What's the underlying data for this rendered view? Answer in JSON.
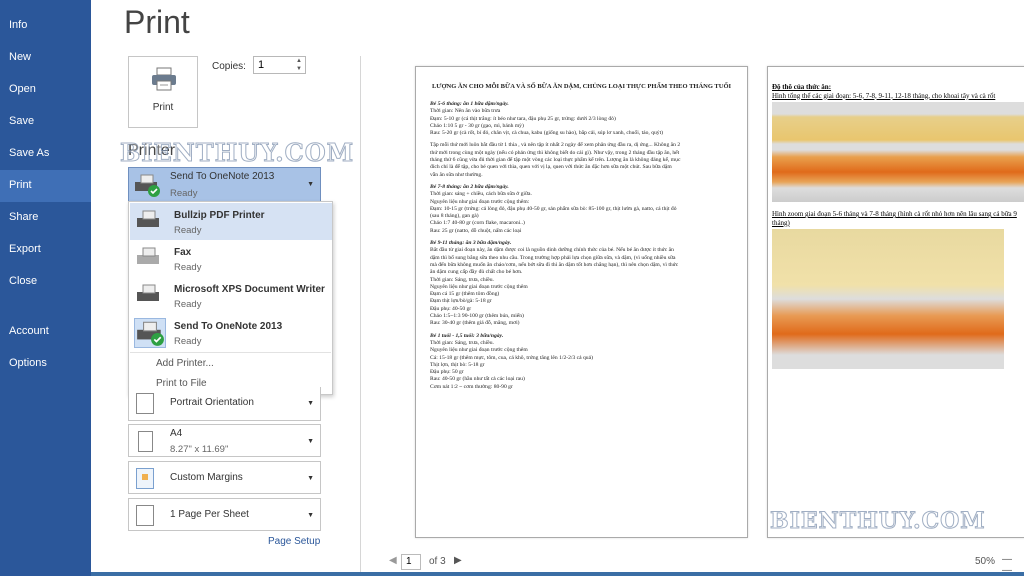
{
  "sidebar": {
    "items": [
      {
        "label": "Info"
      },
      {
        "label": "New"
      },
      {
        "label": "Open"
      },
      {
        "label": "Save"
      },
      {
        "label": "Save As"
      },
      {
        "label": "Print",
        "selected": true
      },
      {
        "label": "Share"
      },
      {
        "label": "Export"
      },
      {
        "label": "Close"
      },
      {
        "label": "Account"
      },
      {
        "label": "Options"
      }
    ],
    "color": "#2b579a"
  },
  "page_title": "Print",
  "print_button": "Print",
  "copies": {
    "label": "Copies:",
    "value": "1"
  },
  "printer": {
    "label": "Printer",
    "selected": {
      "name": "Send To OneNote 2013",
      "status": "Ready"
    },
    "list": [
      {
        "name": "Bullzip PDF Printer",
        "status": "Ready"
      },
      {
        "name": "Fax",
        "status": "Ready"
      },
      {
        "name": "Microsoft XPS Document Writer",
        "status": "Ready"
      },
      {
        "name": "Send To OneNote 2013",
        "status": "Ready"
      }
    ],
    "add_printer": "Add Printer...",
    "print_to_file": "Print to File"
  },
  "settings": [
    {
      "title": "Portrait Orientation"
    },
    {
      "title": "A4",
      "sub": "8.27\" x 11.69\""
    },
    {
      "title": "Custom Margins"
    },
    {
      "title": "1 Page Per Sheet"
    }
  ],
  "page_setup": "Page Setup",
  "watermark": "BIENTHUY.COM",
  "document": {
    "title": "LƯỢNG ĂN CHO MỖI BỮA VÀ SỐ BỮA ĂN DẶM, CHỦNG LOẠI THỰC PHẨM THEO THÁNG TUỔI",
    "lines": [
      {
        "t": "Bé 5-6 tháng: ăn 1 bữa dặm/ngày.",
        "h": true
      },
      {
        "t": "Thời gian: Nên ăn vào bữa trưa"
      },
      {
        "t": "Đạm: 5-10 gr (cá thịt trắng: ít béo như tara, đậu phụ 25 gr, trứng: dưới 2/3 lòng đỏ)"
      },
      {
        "t": "Cháo 1:10 5 gr - 30 gr (gạo, mì, bánh mỳ)"
      },
      {
        "t": "Rau: 5-20 gr (cà rốt, bí đỏ, chân vịt, cà chua, kabu (giống su hào), bắp cải, súp lơ xanh, chuối, táo, quýt)"
      },
      {
        "t": ""
      },
      {
        "t": "Tập mỗi thứ mới luôn bắt đầu từ 1 thìa , và nên tập ít nhất 2 ngày để xem phân ứng đầu ra, dị ứng... Không ăn 2"
      },
      {
        "t": "thứ mới trong cùng một ngày (nếu có phản ứng thì không biết do cái gì). Như vậy, trong 2 tháng đầu tập ăn, hết"
      },
      {
        "t": "tháng thứ 6 cũng vừa đủ thời gian để tập một vòng các loại thực phẩm kể trên. Lượng ăn là không đáng kể, mục"
      },
      {
        "t": "đích chỉ là để tập, cho bé quen với thìa, quen với vị lạ, quen với thức ăn đặc hơn sữa một chút. Sau bữa dặm"
      },
      {
        "t": "vẫn ăn sữa như thường."
      },
      {
        "t": "Bé 7-8 tháng: ăn 2 bữa dặm/ngày.",
        "h": true
      },
      {
        "t": "Thời gian: sáng + chiều, cách bữa sữa ở giữa."
      },
      {
        "t": "Nguyên liệu như giai đoạn trước cộng thêm:"
      },
      {
        "t": "Đạm: 10-15 gr (trứng: cả lòng đỏ, đậu phụ 40-50 gr, sản phẩm sữa bò: 85-100 gr, thịt lườn gà, natto, cá thịt đỏ"
      },
      {
        "t": "(sau 8 tháng), gan gà)"
      },
      {
        "t": "Cháo 1:7 40-80 gr (corn flake, macaroni..)"
      },
      {
        "t": "Rau: 25 gr (natto, đỗ chuột, nấm các loại"
      },
      {
        "t": "Bé 9-11 tháng: ăn 3 bữa dặm/ngày.",
        "h": true
      },
      {
        "t": "Bắt đầu từ giai đoạn này, ăn dặm được coi là nguồn dinh dưỡng chính thức của bé. Nếu bé ăn được ít thức ăn"
      },
      {
        "t": "dặm thì bổ sung bằng sữa theo nhu cầu. Trong trường hợp phải lựa chọn giữa sữa, và dặm, (vì uống nhiều sữa"
      },
      {
        "t": "mà đến bữa không muốn ăn cháo/cơm, nếu bớt sữa đi thì ăn dặm tốt hơn chẳng hạn), thì nên chọn dặm, vì thức"
      },
      {
        "t": "ăn dặm cung cấp đầy đủ chất cho bé hơn."
      },
      {
        "t": "Thời gian: Sáng, trưa, chiều."
      },
      {
        "t": "Nguyên liệu như giai đoạn trước cộng thêm"
      },
      {
        "t": "Đạm cá 15 gr (thêm tôm đồng)"
      },
      {
        "t": "Đạm thịt lợn/bò/gà: 5-18 gr"
      },
      {
        "t": "Đậu phụ: 40-50 gr"
      },
      {
        "t": "Cháo 1:5~1:3 90-100 gr (thêm bún, miến)"
      },
      {
        "t": "Rau: 30-40 gr (thêm giá đỗ, măng, mơi)"
      },
      {
        "t": "Bé 1 tuổi - 1,5 tuổi: 3 bữa/ngày.",
        "h": true
      },
      {
        "t": "Thời gian: Sáng, trưa, chiều."
      },
      {
        "t": "Nguyên liệu như giai đoạn trước cộng thêm"
      },
      {
        "t": "Cá: 15-18 gr (thêm mực, tôm, cua, cá khô, trứng tăng lên 1/2-2/3 cả quả)"
      },
      {
        "t": "Thịt lợn, thịt bò: 5-18 gr"
      },
      {
        "t": "Đậu phụ: 50 gr"
      },
      {
        "t": "Rau: 40-50 gr (hầu như tất cả các loại rau)"
      },
      {
        "t": "Cơm nát 1:2 ~ cơm thường: 80-90 gr"
      }
    ],
    "page2": {
      "heading": "Độ thô của thức ăn:",
      "caption1": "Hình tổng thể các giai đoạn: 5-6, 7-8, 9-11, 12-18 tháng, cho khoai tây và cà rốt",
      "caption2": "Hình zoom giai đoạn 5-6 tháng và 7-8 tháng (hình cà rốt nhỏ hơn nên lâu sang cả bữa 9 tháng)"
    }
  },
  "navigation": {
    "current_page": "1",
    "of_label": "of 3",
    "zoom": "50%"
  }
}
